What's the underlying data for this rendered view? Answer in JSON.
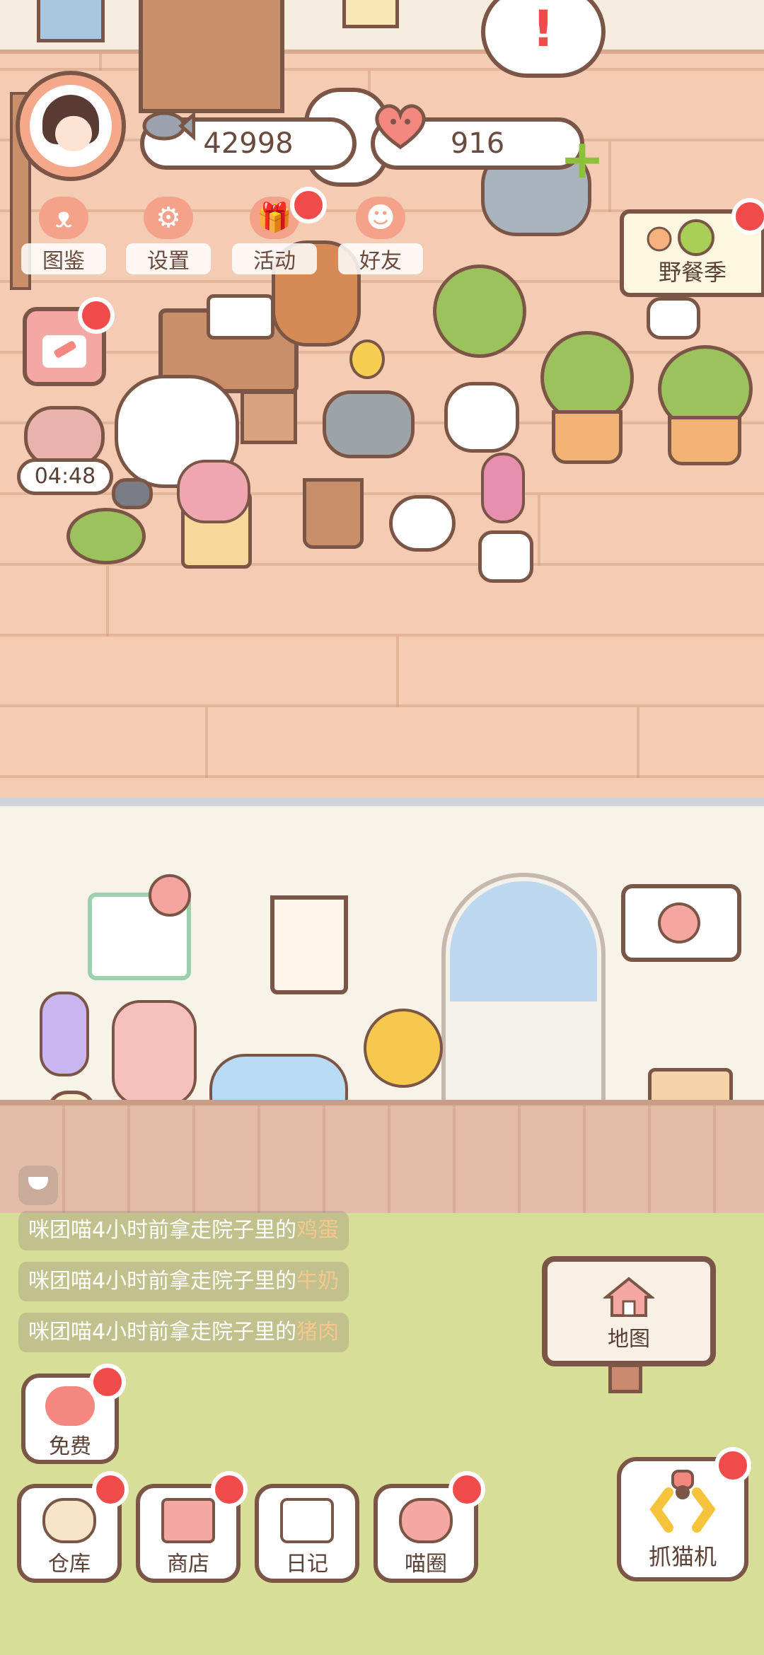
{
  "status_bar": {
    "coins": "42998",
    "hearts": "916",
    "coin_icon": "fish-icon",
    "heart_icon": "heart-face-icon",
    "add_icon": "plus-icon"
  },
  "top_menu": [
    {
      "label": "图鉴",
      "icon": "cat-head-icon"
    },
    {
      "label": "设置",
      "icon": "gear-icon"
    },
    {
      "label": "活动",
      "icon": "gift-icon"
    },
    {
      "label": "好友",
      "icon": "friends-icon"
    }
  ],
  "event_banner": {
    "label": "野餐季"
  },
  "timer": "04:48",
  "alert_bubble": "!",
  "messages": [
    {
      "prefix": "咪团喵4小时前拿走院子里的",
      "item": "鸡蛋"
    },
    {
      "prefix": "咪团喵4小时前拿走院子里的",
      "item": "牛奶"
    },
    {
      "prefix": "咪团喵4小时前拿走院子里的",
      "item": "猪肉"
    }
  ],
  "map_sign": {
    "label": "地图",
    "icon": "house-icon"
  },
  "free_button": {
    "label": "免费",
    "icon": "heart-icon"
  },
  "bottom_nav": [
    {
      "label": "仓库",
      "icon": "storage-icon"
    },
    {
      "label": "商店",
      "icon": "shop-icon"
    },
    {
      "label": "日记",
      "icon": "diary-icon"
    },
    {
      "label": "喵圈",
      "icon": "cat-planet-icon"
    }
  ],
  "claw_button": {
    "label": "抓猫机",
    "icon": "claw-icon"
  },
  "colors": {
    "outline": "#7b5546",
    "notification_red": "#ef4b4b",
    "accent_green": "#8dc13b",
    "floor": "#f4cbb3",
    "grass": "#d7de98"
  }
}
